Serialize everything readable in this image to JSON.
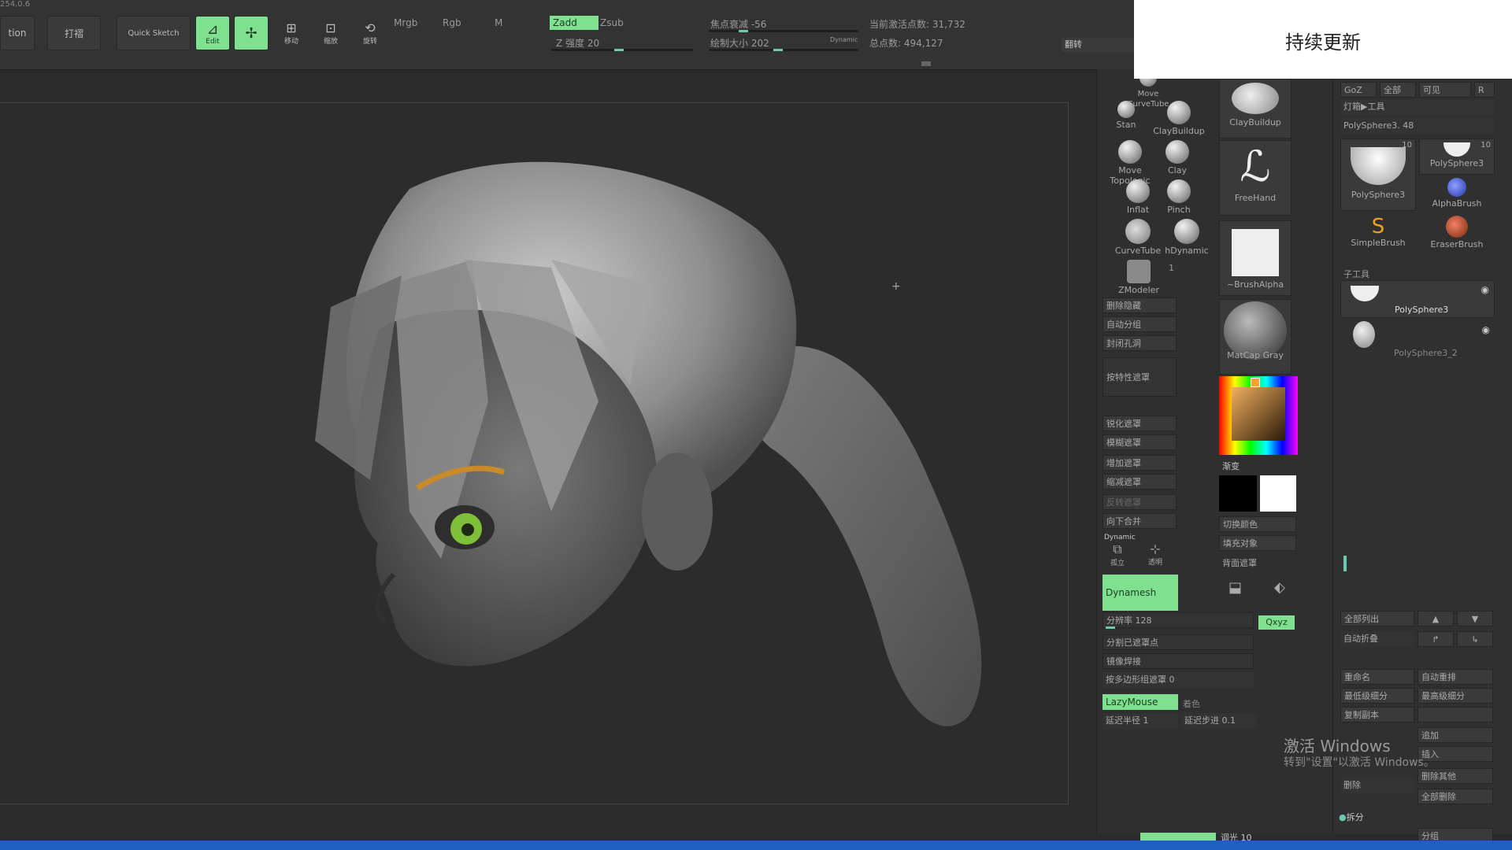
{
  "overlay": {
    "title": "持续更新"
  },
  "toolbar": {
    "coords": "254,0.6",
    "action_label": "tion",
    "edit_label": "打褶",
    "quick_sketch": "Quick Sketch",
    "draw": "Edit",
    "move": "移动",
    "scale": "缩放",
    "rotate": "旋转",
    "mrgb": "Mrgb",
    "rgb": "Rgb",
    "m": "M",
    "zadd": "Zadd",
    "zsub": "Zsub",
    "z_intensity": "Z 强度 20",
    "focal_shift": "焦点衰减 -56",
    "draw_size": "绘制大小 202",
    "dynamic": "Dynamic",
    "active_points": "当前激活点数: 31,732",
    "total_points": "总点数: 494,127",
    "flip": "翻转"
  },
  "brushes": {
    "items": [
      {
        "label": "Move CurveTube"
      },
      {
        "label": "Stan"
      },
      {
        "label": "ClayBuildup"
      },
      {
        "label": "Move Topologic"
      },
      {
        "label": "Clay"
      },
      {
        "label": "Inflat"
      },
      {
        "label": "Pinch"
      },
      {
        "label": "CurveTube"
      },
      {
        "label": "hDynamic"
      },
      {
        "label": "ZModeler"
      }
    ],
    "zmodeler_count": "1",
    "current_brush": "ClayBuildup",
    "stroke": "FreeHand",
    "alpha": "~BrushAlpha",
    "material": "MatCap Gray"
  },
  "menu": {
    "items": [
      "删除隐藏",
      "自动分组",
      "封闭孔洞",
      "按特性遮罩",
      "锐化遮罩",
      "模糊遮罩",
      "增加遮罩",
      "缩减遮罩",
      "反转遮罩",
      "向下合并"
    ],
    "dynamic": "Dynamic",
    "solo": "孤立",
    "transp": "透明",
    "dynamesh": "Dynamesh",
    "resolution": "分辨率 128",
    "split_masked": "分割已遮罩点",
    "mirror_weld": "镜像焊接",
    "polygroup_mask": "按多边形组遮罩 0",
    "lazymouse": "LazyMouse",
    "color": "着色",
    "lazy_radius": "延迟半径 1",
    "lazy_step": "延迟步进 0.1",
    "gradient": "渐变",
    "switch_color": "切换颜色",
    "fill_object": "填充对象",
    "backface_mask": "背面遮罩",
    "xyz": "Qxyz"
  },
  "subtool": {
    "tabs": [
      "GoZ",
      "全部",
      "可见",
      "R"
    ],
    "load_tool": "灯箱▶工具",
    "polysphere_count": "PolySphere3. 48",
    "thumbs": [
      {
        "label": "PolySphere3",
        "count": "10"
      },
      {
        "label": "PolySphere3",
        "count": "10"
      },
      {
        "label": "AlphaBrush"
      },
      {
        "label": "SimpleBrush"
      },
      {
        "label": "EraserBrush"
      }
    ],
    "section_title": "子工具",
    "list": [
      {
        "label": "PolySphere3"
      },
      {
        "label": "PolySphere3_2"
      }
    ],
    "buttons": [
      "全部列出",
      "自动折叠",
      "重命名",
      "自动重排",
      "最低级细分",
      "最高级细分",
      "复制副本",
      "",
      "追加",
      "",
      "插入",
      "删除",
      "删除其他",
      "全部删除"
    ],
    "subdivide": "拆分",
    "split": "分组"
  },
  "watermark": {
    "line1": "激活 Windows",
    "line2": "转到\"设置\"以激活 Windows。"
  },
  "bottom": {
    "radius": "调光 10"
  },
  "colors": {
    "accent_green": "#7fe08f",
    "taskbar_blue": "#1f5fbf"
  }
}
